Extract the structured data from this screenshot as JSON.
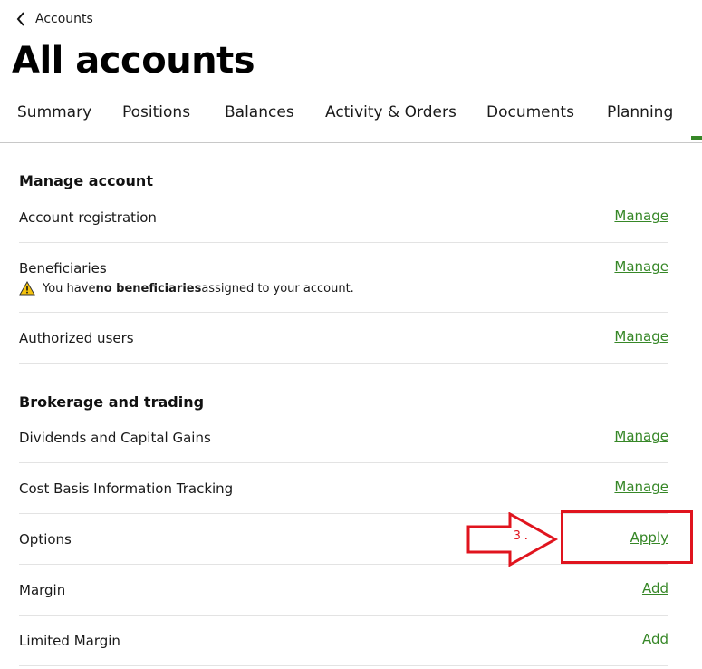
{
  "breadcrumb": {
    "back_label": "Accounts"
  },
  "page_title": "All accounts",
  "tabs": [
    {
      "label": "Summary"
    },
    {
      "label": "Positions"
    },
    {
      "label": "Balances"
    },
    {
      "label": "Activity & Orders"
    },
    {
      "label": "Documents"
    },
    {
      "label": "Planning"
    }
  ],
  "sections": {
    "manage_account": {
      "title": "Manage account",
      "rows": [
        {
          "label": "Account registration",
          "action": "Manage"
        },
        {
          "label": "Beneficiaries",
          "action": "Manage",
          "warning_prefix": "You have ",
          "warning_bold": "no beneficiaries",
          "warning_suffix": " assigned to your account."
        },
        {
          "label": "Authorized users",
          "action": "Manage"
        }
      ]
    },
    "brokerage": {
      "title": "Brokerage and trading",
      "rows": [
        {
          "label": "Dividends and Capital Gains",
          "action": "Manage"
        },
        {
          "label": "Cost Basis Information Tracking",
          "action": "Manage"
        },
        {
          "label": "Options",
          "action": "Apply"
        },
        {
          "label": "Margin",
          "action": "Add"
        },
        {
          "label": "Limited Margin",
          "action": "Add"
        }
      ]
    }
  },
  "annotation": {
    "step": "3.",
    "color": "#e0141e"
  },
  "colors": {
    "link": "#368727",
    "divider": "#e3e3e3",
    "warning": "#f4c20d"
  },
  "icons": {
    "back": "chevron-left-icon",
    "warning": "warning-triangle-icon"
  }
}
